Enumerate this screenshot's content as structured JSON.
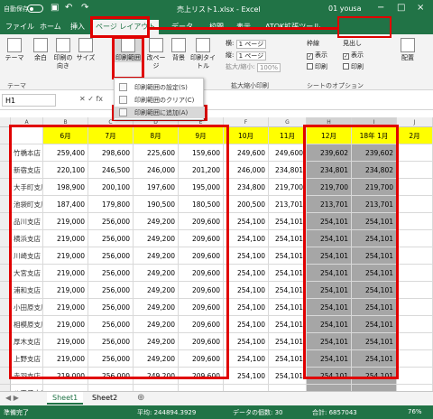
{
  "titlebar": {
    "autosave": "自動保存",
    "toggle": "オフ",
    "filename": "売上リスト1.xlsx  -  Excel",
    "user": "01 yousa"
  },
  "tabs": [
    "ファイル",
    "ホーム",
    "挿入",
    "ページ レイアウト",
    "データ",
    "校閲",
    "表示",
    "ATOK拡張ツール"
  ],
  "ribbon": {
    "theme": "テーマ",
    "margins": "余白",
    "orientation": "印刷の向き",
    "size": "サイズ",
    "print_area": "印刷範囲",
    "breaks": "改ページ",
    "background": "背景",
    "print_titles": "印刷タイトル",
    "width_label": "横:",
    "width_value": "1 ページ",
    "height_label": "縦:",
    "height_value": "1 ページ",
    "scale_label": "拡大/縮小:",
    "scale_value": "100%",
    "gridlines": "枠線",
    "headings": "見出し",
    "view": "表示",
    "print": "印刷",
    "arrange": "配置",
    "group_theme": "テーマ",
    "group_scale": "拡大縮小印刷",
    "group_sheet": "シートのオプション"
  },
  "namebox": "H1",
  "dropdown": {
    "items": [
      "印刷範囲の設定(S)",
      "印刷範囲のクリア(C)",
      "印刷範囲に追加(A)"
    ]
  },
  "columns": [
    "A",
    "B",
    "C",
    "D",
    "E",
    "F",
    "G",
    "H",
    "I",
    "J"
  ],
  "headers": [
    "6月",
    "7月",
    "8月",
    "9月",
    "10月",
    "11月",
    "12月",
    "18年 1月",
    "2月"
  ],
  "rows": [
    {
      "store": "竹橋本店",
      "v": [
        "259,400",
        "298,600",
        "225,600",
        "159,600",
        "249,600",
        "249,600",
        "239,602",
        "239,602"
      ]
    },
    {
      "store": "新宿支店",
      "v": [
        "220,100",
        "246,500",
        "246,000",
        "201,200",
        "246,000",
        "234,801",
        "234,801",
        "234,802"
      ]
    },
    {
      "store": "大手町支店",
      "v": [
        "198,900",
        "200,100",
        "197,600",
        "195,000",
        "234,800",
        "219,700",
        "219,700",
        "219,700"
      ]
    },
    {
      "store": "池袋町支店",
      "v": [
        "187,400",
        "179,800",
        "190,500",
        "180,500",
        "200,500",
        "213,701",
        "213,701",
        "213,701"
      ]
    },
    {
      "store": "品川支店",
      "v": [
        "219,000",
        "256,000",
        "249,200",
        "209,600",
        "254,100",
        "254,101",
        "254,101",
        "254,101"
      ]
    },
    {
      "store": "横浜支店",
      "v": [
        "219,000",
        "256,000",
        "249,200",
        "209,600",
        "254,100",
        "254,101",
        "254,101",
        "254,101"
      ]
    },
    {
      "store": "川崎支店",
      "v": [
        "219,000",
        "256,000",
        "249,200",
        "209,600",
        "254,100",
        "254,101",
        "254,101",
        "254,101"
      ]
    },
    {
      "store": "大宮支店",
      "v": [
        "219,000",
        "256,000",
        "249,200",
        "209,600",
        "254,100",
        "254,101",
        "254,101",
        "254,101"
      ]
    },
    {
      "store": "浦和支店",
      "v": [
        "219,000",
        "256,000",
        "249,200",
        "209,600",
        "254,100",
        "254,101",
        "254,101",
        "254,101"
      ]
    },
    {
      "store": "小田原支店",
      "v": [
        "219,000",
        "256,000",
        "249,200",
        "209,600",
        "254,100",
        "254,101",
        "254,101",
        "254,101"
      ]
    },
    {
      "store": "相模原支店",
      "v": [
        "219,000",
        "256,000",
        "249,200",
        "209,600",
        "254,100",
        "254,101",
        "254,101",
        "254,101"
      ]
    },
    {
      "store": "厚木支店",
      "v": [
        "219,000",
        "256,000",
        "249,200",
        "209,600",
        "254,100",
        "254,101",
        "254,101",
        "254,101"
      ]
    },
    {
      "store": "上野支店",
      "v": [
        "219,000",
        "256,000",
        "249,200",
        "209,600",
        "254,100",
        "254,101",
        "254,101",
        "254,101"
      ]
    },
    {
      "store": "赤羽支店",
      "v": [
        "219,000",
        "256,000",
        "249,200",
        "209,600",
        "254,100",
        "254,101",
        "254,101",
        "254,101"
      ]
    },
    {
      "store": "八王子支店",
      "v": [
        "",
        "",
        "",
        "",
        "",
        "",
        "",
        ""
      ]
    }
  ],
  "sheets": [
    "Sheet1",
    "Sheet2"
  ],
  "status": {
    "ready": "準備完了",
    "average": "平均: 244894.3929",
    "count": "データの個数: 30",
    "sum": "合計: 6857043",
    "zoom": "76%"
  },
  "colors": {
    "excel_green": "#217346",
    "highlight_red": "#e00000",
    "header_yellow": "#ffff00",
    "selected_gray": "#a6a6a6"
  }
}
